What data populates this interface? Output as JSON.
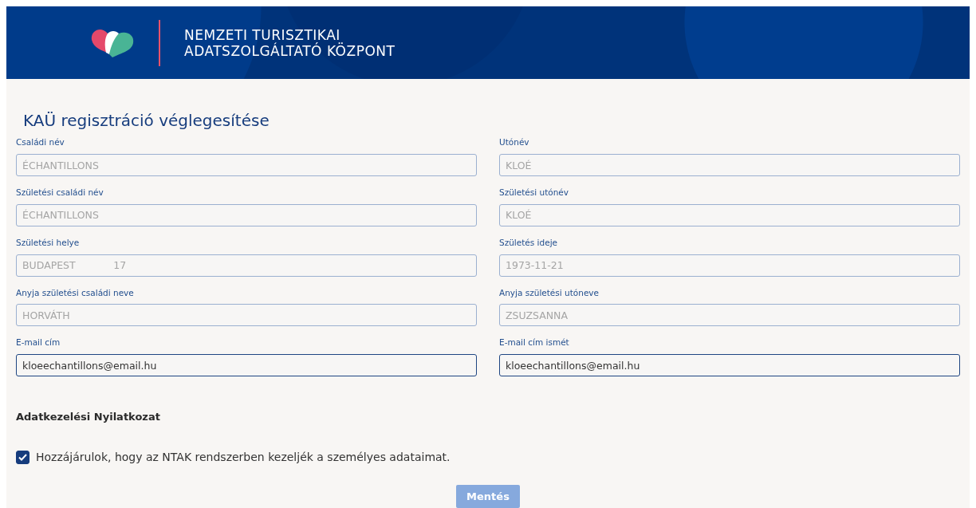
{
  "header": {
    "title_lines": [
      "NEMZETI TURISZTIKAI",
      "ADATSZOLGÁLTATÓ KÖZPONT"
    ]
  },
  "page_title": "KAÜ regisztráció véglegesítése",
  "fields": [
    {
      "label": "Családi név",
      "value": "ÉCHANTILLONS",
      "disabled": true
    },
    {
      "label": "Utónév",
      "value": "KLOÉ",
      "disabled": true
    },
    {
      "label": "Születési családi név",
      "value": "ÉCHANTILLONS",
      "disabled": true
    },
    {
      "label": "Születési utónév",
      "value": "KLOÉ",
      "disabled": true
    },
    {
      "label": "Születési helye",
      "value": "BUDAPEST            17",
      "disabled": true
    },
    {
      "label": "Születés ideje",
      "value": "1973-11-21",
      "disabled": true
    },
    {
      "label": "Anyja születési családi neve",
      "value": "HORVÁTH",
      "disabled": true
    },
    {
      "label": "Anyja születési utóneve",
      "value": "ZSUZSANNA",
      "disabled": true
    },
    {
      "label": "E-mail cím",
      "value": "kloeechantillons@email.hu",
      "disabled": false
    },
    {
      "label": "E-mail cím ismét",
      "value": "kloeechantillons@email.hu",
      "disabled": false
    }
  ],
  "consent": {
    "heading": "Adatkezelési Nyilatkozat",
    "label": "Hozzájárulok, hogy az NTAK rendszerben kezeljék a személyes adataimat.",
    "checked": true
  },
  "save_button": {
    "label": "Mentés",
    "disabled": true
  }
}
